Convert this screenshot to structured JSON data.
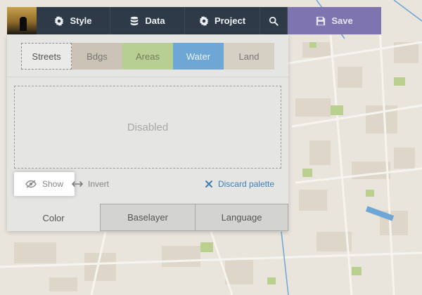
{
  "toolbar": {
    "style_label": "Style",
    "data_label": "Data",
    "project_label": "Project",
    "save_label": "Save"
  },
  "layer_tabs": {
    "streets": "Streets",
    "bdgs": "Bdgs",
    "areas": "Areas",
    "water": "Water",
    "land": "Land"
  },
  "preview": {
    "text": "Disabled"
  },
  "actions": {
    "show": "Show",
    "invert": "Invert",
    "discard": "Discard palette"
  },
  "bottom_tabs": {
    "color": "Color",
    "baselayer": "Baselayer",
    "language": "Language"
  },
  "colors": {
    "toolbar_bg": "#2e3a47",
    "save_bg": "#7e74b0",
    "streets": "#eaeae8",
    "bdgs": "#cbc4b6",
    "areas": "#b8cf94",
    "water": "#6ea6d6",
    "land": "#d6cfc4",
    "link": "#3f7fb6"
  }
}
